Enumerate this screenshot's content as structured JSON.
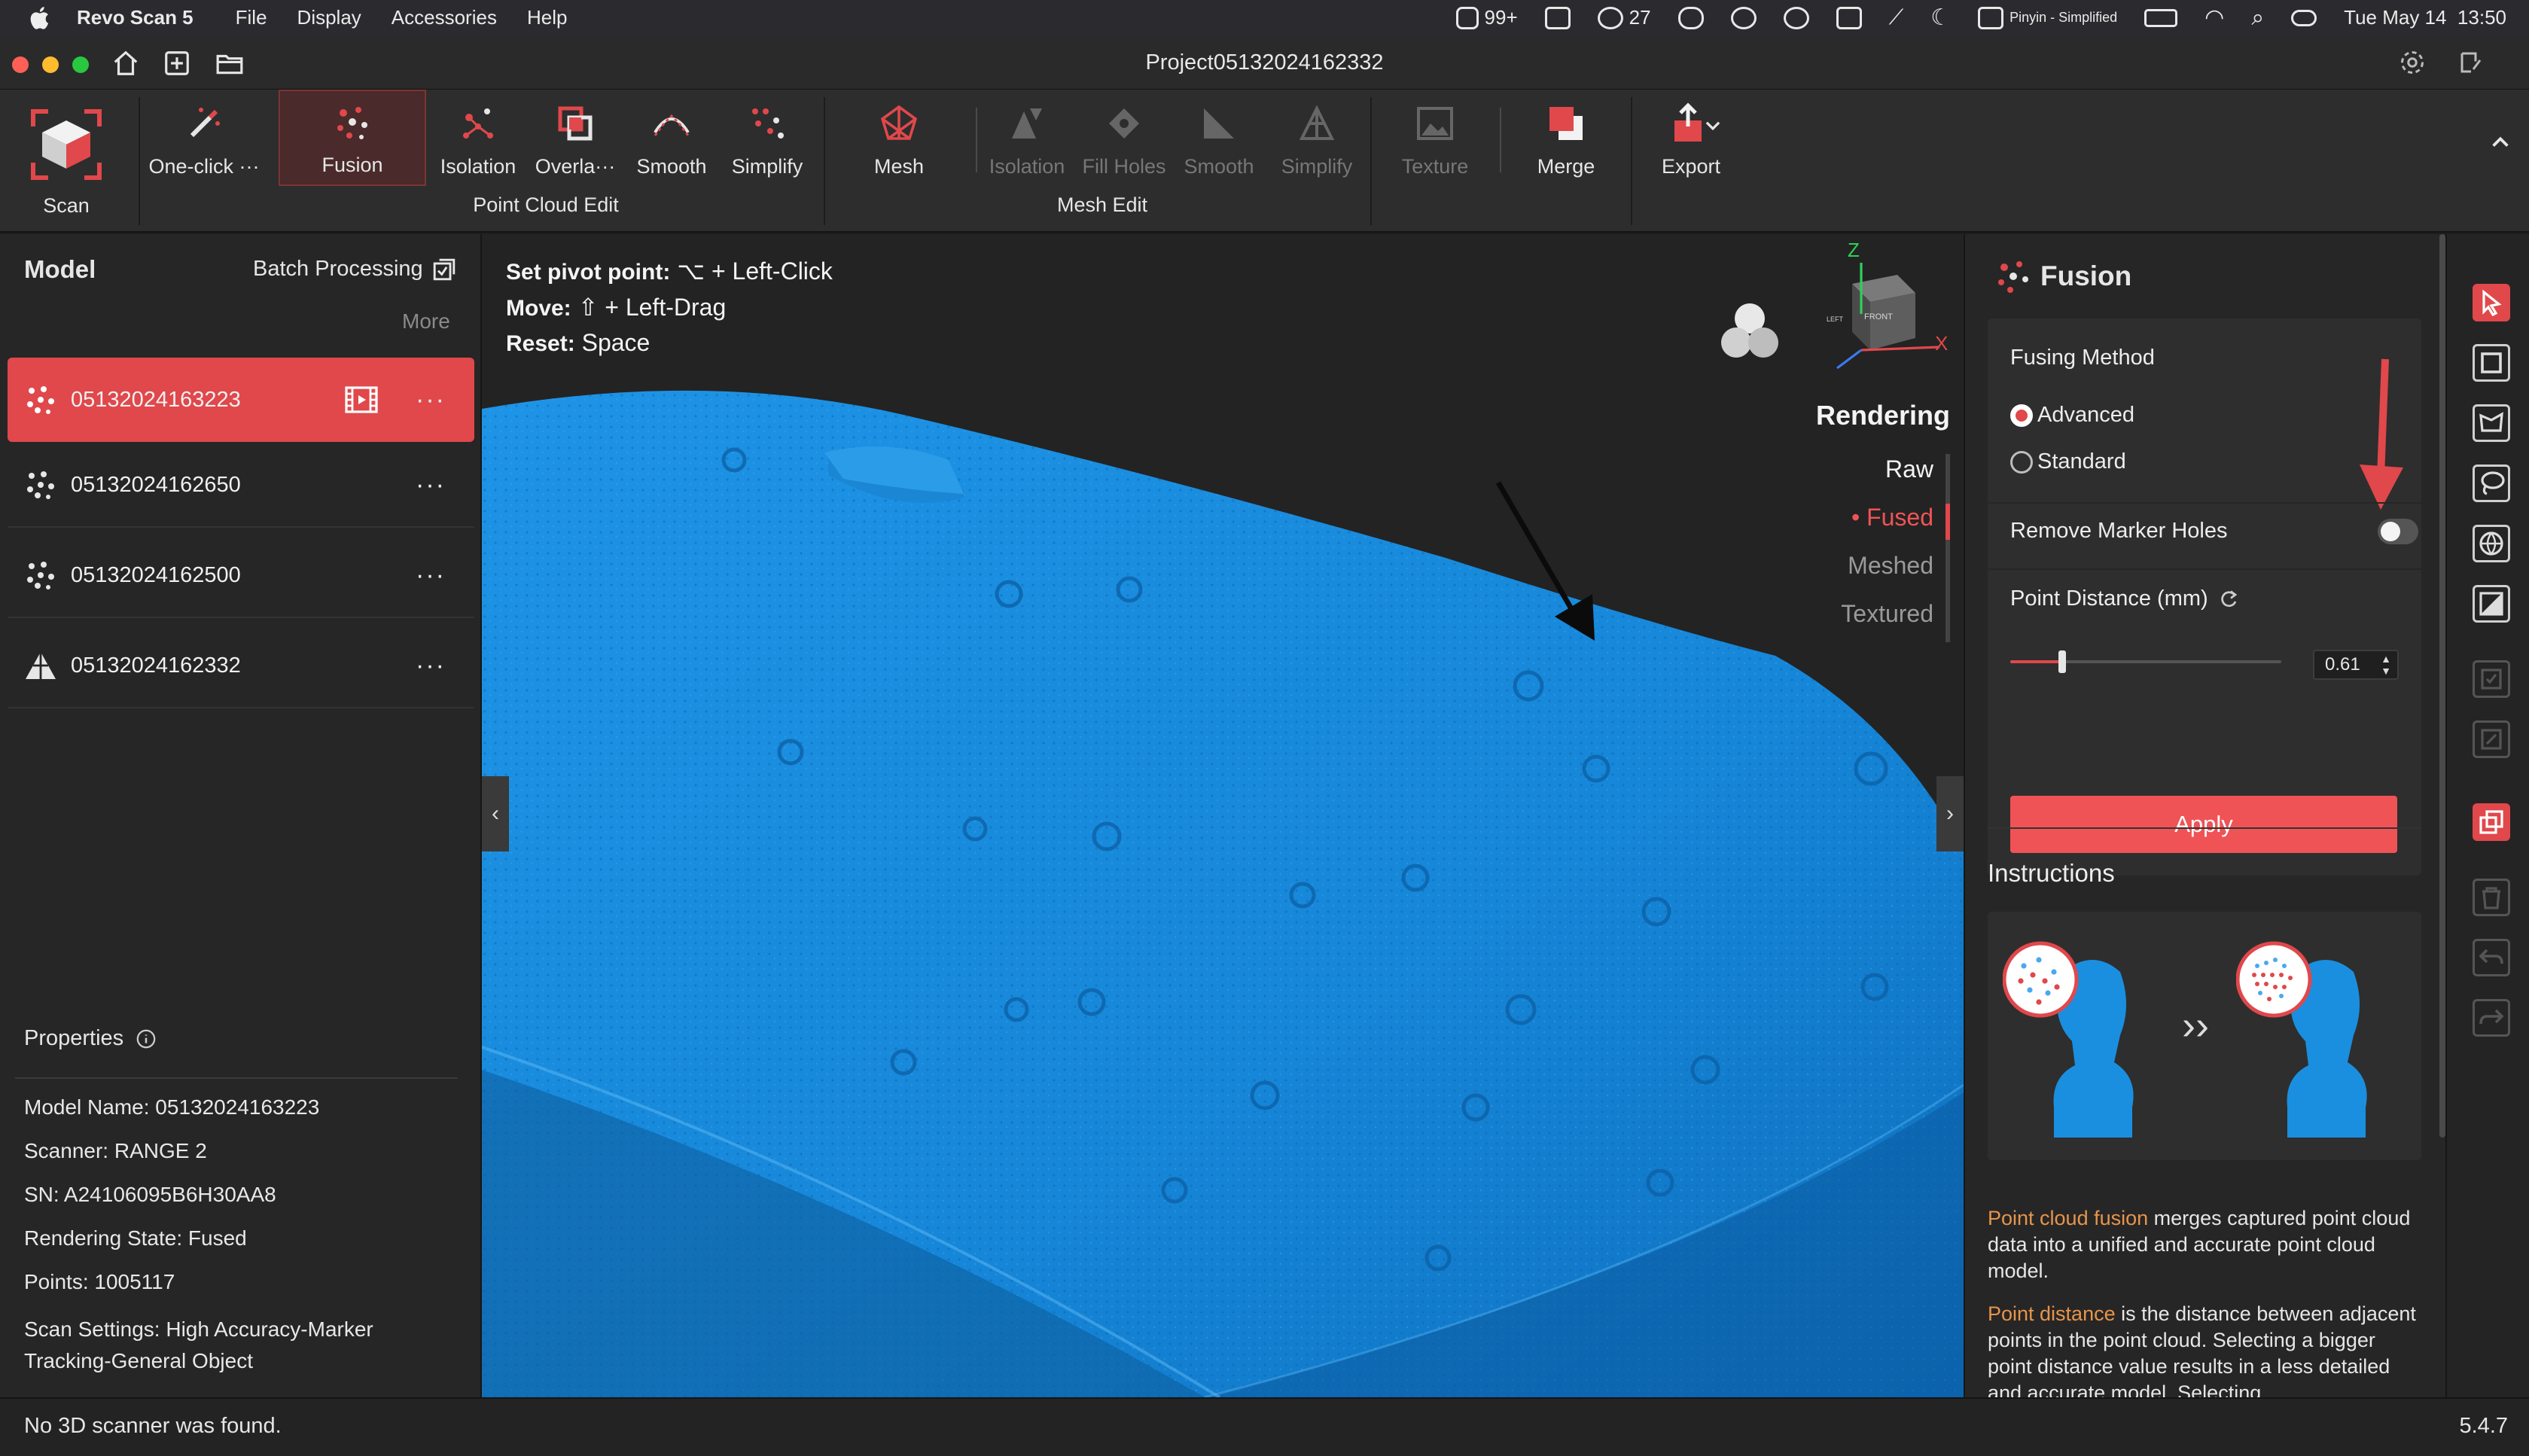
{
  "menubar": {
    "app_name": "Revo Scan 5",
    "items": [
      "File",
      "Display",
      "Accessories",
      "Help"
    ],
    "tray": {
      "notif_count": "99+",
      "wechat_count": "27",
      "input_method": "Pinyin - Simplified",
      "datetime": "Tue May 14  13:50"
    }
  },
  "window": {
    "title": "Project05132024162332"
  },
  "ribbon": {
    "scan": "Scan",
    "pc_buttons": [
      "One-click ···",
      "Fusion",
      "Isolation",
      "Overla···",
      "Smooth",
      "Simplify"
    ],
    "pc_group": "Point Cloud Edit",
    "mesh_buttons": [
      "Mesh",
      "Isolation",
      "Fill Holes",
      "Smooth",
      "Simplify"
    ],
    "mesh_group": "Mesh Edit",
    "texture": "Texture",
    "merge": "Merge",
    "export": "Export"
  },
  "left_panel": {
    "title": "Model",
    "batch": "Batch Processing",
    "more": "More",
    "models": [
      {
        "name": "05132024163223",
        "type": "pointcloud",
        "selected": true
      },
      {
        "name": "05132024162650",
        "type": "pointcloud",
        "selected": false
      },
      {
        "name": "05132024162500",
        "type": "pointcloud",
        "selected": false
      },
      {
        "name": "05132024162332",
        "type": "mesh",
        "selected": false
      }
    ],
    "menu_dots": "···",
    "properties": {
      "title": "Properties",
      "model_name_label": "Model Name:",
      "model_name": "05132024163223",
      "scanner_label": "Scanner:",
      "scanner": "RANGE 2",
      "sn_label": "SN:",
      "sn": "A24106095B6H30AA8",
      "state_label": "Rendering State:",
      "state": "Fused",
      "points_label": "Points:",
      "points": "1005117",
      "settings_label": "Scan Settings:",
      "settings_line1": "High Accuracy-Marker",
      "settings_line2": "Tracking-General Object"
    }
  },
  "viewport": {
    "hints": [
      {
        "label": "Set pivot point:",
        "value": "⌥ + Left-Click"
      },
      {
        "label": "Move:",
        "value": "⇧ + Left-Drag"
      },
      {
        "label": "Reset:",
        "value": "Space"
      }
    ],
    "axes": {
      "z": "Z",
      "x": "X",
      "front": "FRONT",
      "left": "LEFT"
    },
    "rendering": {
      "title": "Rendering",
      "items": [
        "Raw",
        "• Fused",
        "Meshed",
        "Textured"
      ],
      "active_index": 1
    }
  },
  "right_panel": {
    "title": "Fusion",
    "fusing_method": "Fusing Method",
    "option_advanced": "Advanced",
    "option_standard": "Standard",
    "selected": "Advanced",
    "remove_marker_holes": "Remove Marker Holes",
    "remove_marker_holes_on": false,
    "point_distance_label": "Point Distance (mm)",
    "point_distance_value": "0.61",
    "apply": "Apply",
    "instructions_title": "Instructions",
    "instr_arrow": "››",
    "desc1_highlight": "Point cloud fusion",
    "desc1_rest": " merges captured point cloud data into a unified and accurate point cloud model.",
    "desc2_highlight": "Point distance",
    "desc2_rest": " is the distance between adjacent points in the point cloud. Selecting a bigger point distance value results in a less detailed and accurate model. Selecting"
  },
  "statusbar": {
    "message": "No 3D scanner was found.",
    "version": "5.4.7"
  },
  "colors": {
    "accent": "#e0484b",
    "orange_text": "#e8944a",
    "scan_blue": "#1a8fe0"
  }
}
